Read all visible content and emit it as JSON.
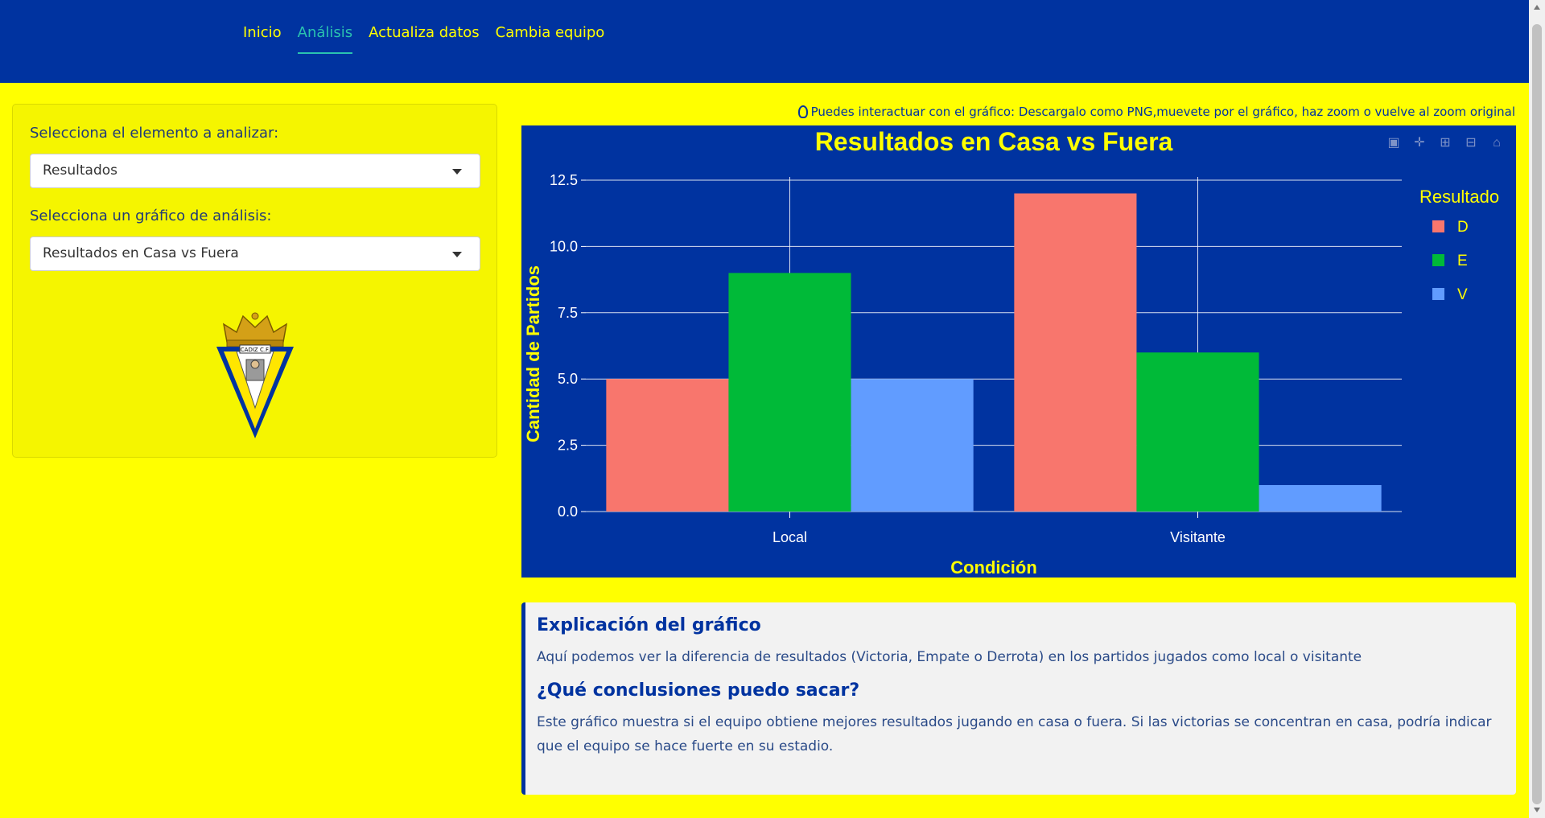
{
  "nav": {
    "items": [
      {
        "label": "Inicio"
      },
      {
        "label": "Análisis"
      },
      {
        "label": "Actualiza datos"
      },
      {
        "label": "Cambia equipo"
      }
    ]
  },
  "sidebar": {
    "element_label": "Selecciona el elemento a analizar:",
    "element_value": "Resultados",
    "chart_label": "Selecciona un gráfico de análisis:",
    "chart_value": "Resultados en Casa vs Fuera",
    "crest_text": "CADIZ C.F."
  },
  "hint": "Puedes interactuar con el gráfico: Descargalo como PNG,muevete por el gráfico, haz zoom o vuelve al zoom original",
  "chart_data": {
    "type": "bar",
    "title": "Resultados en Casa vs Fuera",
    "xlabel": "Condición",
    "ylabel": "Cantidad de Partidos",
    "categories": [
      "Local",
      "Visitante"
    ],
    "ylim": [
      0,
      12.5
    ],
    "yticks": [
      "0.0",
      "2.5",
      "5.0",
      "7.5",
      "10.0",
      "12.5"
    ],
    "legend_title": "Resultado",
    "legend_position": "right",
    "series": [
      {
        "name": "D",
        "values": [
          5,
          12
        ],
        "color": "#f8766d"
      },
      {
        "name": "E",
        "values": [
          9,
          6
        ],
        "color": "#00ba38"
      },
      {
        "name": "V",
        "values": [
          5,
          1
        ],
        "color": "#619cff"
      }
    ],
    "colors": {
      "background": "#0033a0",
      "title": "#ffff00",
      "axis_text": "#ffffff",
      "grid": "#ffffff"
    }
  },
  "info": {
    "heading1": "Explicación del gráfico",
    "text1": "Aquí podemos ver la diferencia de resultados (Victoria, Empate o Derrota) en los partidos jugados como local o visitante",
    "heading2": "¿Qué conclusiones puedo sacar?",
    "text2": "Este gráfico muestra si el equipo obtiene mejores resultados jugando en casa o fuera. Si las victorias se concentran en casa, podría indicar que el equipo se hace fuerte en su estadio."
  }
}
